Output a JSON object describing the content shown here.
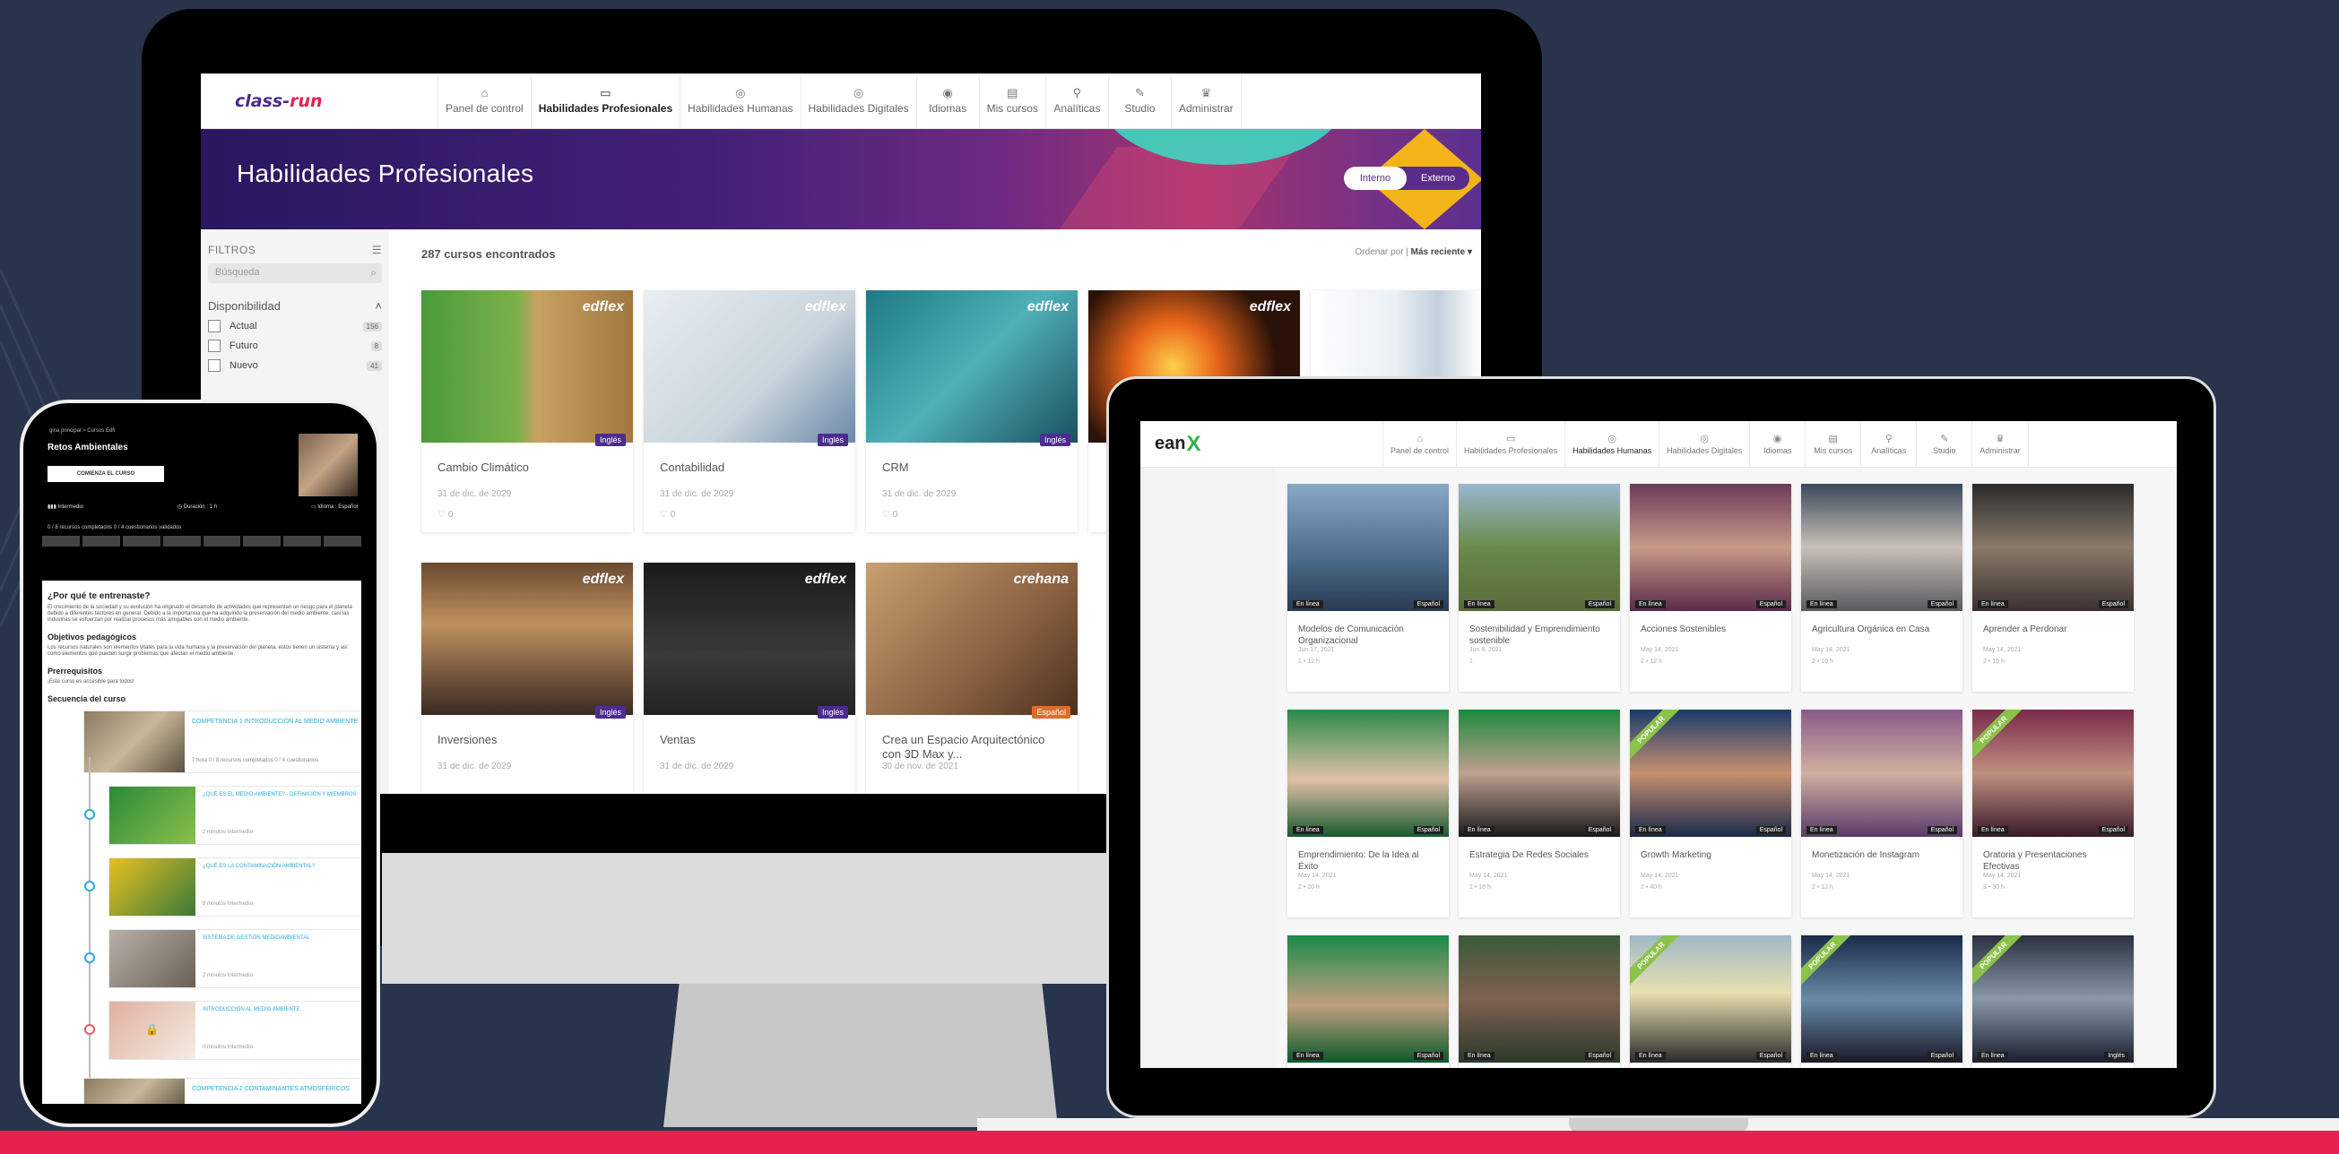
{
  "monitor": {
    "logo": {
      "part1": "class-",
      "part2": "run"
    },
    "nav": [
      {
        "icon": "⌂",
        "label": "Panel de control",
        "active": false
      },
      {
        "icon": "▭",
        "label": "Habilidades Profesionales",
        "active": true
      },
      {
        "icon": "◎",
        "label": "Habilidades Humanas",
        "active": false
      },
      {
        "icon": "◎",
        "label": "Habilidades Digitales",
        "active": false
      },
      {
        "icon": "◉",
        "label": "Idiomas",
        "active": false
      },
      {
        "icon": "▤",
        "label": "Mis cursos",
        "active": false
      },
      {
        "icon": "⚲",
        "label": "Analíticas",
        "active": false
      },
      {
        "icon": "✎",
        "label": "Studio",
        "active": false
      },
      {
        "icon": "♛",
        "label": "Administrar",
        "active": false
      }
    ],
    "hero_title": "Habilidades Profesionales",
    "toggle": {
      "interno": "Interno",
      "externo": "Externo"
    },
    "filters": {
      "title": "FILTROS",
      "search_placeholder": "Búsqueda",
      "section": "Disponibilidad",
      "options": [
        {
          "label": "Actual",
          "count": "156"
        },
        {
          "label": "Futuro",
          "count": "8"
        },
        {
          "label": "Nuevo",
          "count": "41"
        }
      ]
    },
    "results": "287 cursos encontrados",
    "sort": {
      "label": "Ordenar por |",
      "value": "Más reciente ▾"
    },
    "cards": [
      {
        "title": "Cambio Climático",
        "date": "31 de dic. de 2029",
        "likes": "0",
        "lang": "Inglés",
        "brand": "edflex"
      },
      {
        "title": "Contabilidad",
        "date": "31 de dic. de 2029",
        "likes": "0",
        "lang": "Inglés",
        "brand": "edflex"
      },
      {
        "title": "CRM",
        "date": "31 de dic. de 2029",
        "likes": "0",
        "lang": "Inglés",
        "brand": "edflex"
      },
      {
        "title": "",
        "date": "",
        "likes": "",
        "lang": "",
        "brand": "edflex"
      },
      {
        "title": "Inversiones",
        "date": "31 de dic. de 2029",
        "likes": "",
        "lang": "Inglés",
        "brand": "edflex"
      },
      {
        "title": "Ventas",
        "date": "31 de dic. de 2029",
        "likes": "",
        "lang": "Inglés",
        "brand": "edflex"
      },
      {
        "title": "Crea un Espacio Arquitectónico con 3D Max y...",
        "date": "30 de nov. de 2021",
        "likes": "",
        "lang": "Español",
        "brand": "crehana"
      }
    ]
  },
  "laptop": {
    "logo": {
      "part1": "ean",
      "part2": "X"
    },
    "nav": [
      {
        "icon": "⌂",
        "label": "Panel de control"
      },
      {
        "icon": "▭",
        "label": "Habilidades Profesionales"
      },
      {
        "icon": "◎",
        "label": "Habilidades Humanas"
      },
      {
        "icon": "◎",
        "label": "Habilidades Digitales"
      },
      {
        "icon": "◉",
        "label": "Idiomas"
      },
      {
        "icon": "▤",
        "label": "Mis cursos"
      },
      {
        "icon": "⚲",
        "label": "Analíticas"
      },
      {
        "icon": "✎",
        "label": "Studio"
      },
      {
        "icon": "♛",
        "label": "Administrar"
      }
    ],
    "tag_online": "En línea",
    "cards": [
      {
        "title": "Modelos de Comunicación Organizacional",
        "date": "Jun 17, 2021",
        "meta": "1 • 12 h",
        "lang": "Español",
        "popular": false
      },
      {
        "title": "Sostenibilidad y Emprendimiento sostenible",
        "date": "Jun 8, 2021",
        "meta": "1",
        "lang": "Español",
        "popular": false
      },
      {
        "title": "Acciones Sostenibles",
        "date": "May 14, 2021",
        "meta": "2 • 12 h",
        "lang": "Español",
        "popular": false
      },
      {
        "title": "Agricultura Orgánica en Casa",
        "date": "May 14, 2021",
        "meta": "2 • 10 h",
        "lang": "Español",
        "popular": false
      },
      {
        "title": "Aprender a Perdonar",
        "date": "May 14, 2021",
        "meta": "2 • 15 h",
        "lang": "Español",
        "popular": false
      },
      {
        "title": "Emprendimiento: De la Idea al Éxito",
        "date": "May 14, 2021",
        "meta": "2 • 20 h",
        "lang": "Español",
        "popular": false
      },
      {
        "title": "Estrategia De Redes Sociales",
        "date": "May 14, 2021",
        "meta": "2 • 18 h",
        "lang": "Español",
        "popular": false
      },
      {
        "title": "Growth Marketing",
        "date": "May 14, 2021",
        "meta": "2 • 40 h",
        "lang": "Español",
        "popular": true
      },
      {
        "title": "Monetización de Instagram",
        "date": "May 14, 2021",
        "meta": "2 • 12 h",
        "lang": "Español",
        "popular": false
      },
      {
        "title": "Oratoria y Presentaciones Efectivas",
        "date": "May 14, 2021",
        "meta": "3 • 30 h",
        "lang": "Español",
        "popular": true
      },
      {
        "title": "",
        "date": "",
        "meta": "",
        "lang": "Español",
        "popular": false
      },
      {
        "title": "",
        "date": "",
        "meta": "",
        "lang": "Español",
        "popular": false
      },
      {
        "title": "",
        "date": "",
        "meta": "",
        "lang": "Español",
        "popular": true
      },
      {
        "title": "",
        "date": "",
        "meta": "",
        "lang": "Español",
        "popular": true
      },
      {
        "title": "",
        "date": "",
        "meta": "",
        "lang": "Inglés",
        "popular": true
      }
    ],
    "popular_label": "POPULAR"
  },
  "phone": {
    "breadcrumb": "gina principal > Cursos Edfi",
    "title": "Retos Ambientales",
    "start_button": "COMIENZA EL CURSO",
    "stats": {
      "level": "Intermedio",
      "duration": "Duración : 1 h",
      "language": "Idioma : Español"
    },
    "progress": "0 / 8 recursos completados    0 / 4 cuestionarios validados",
    "why_title": "¿Por qué te entrenaste?",
    "why_text": "El crecimiento de la sociedad y su evolución ha originado el desarrollo de actividades que representan un riesgo para el planeta debido a diferentes factores en general. Debido a la importancia que ha adquirido la preservación del medio ambiente, casi las industrias se esfuerzan por realizar procesos más amigables con el medio ambiente.",
    "objectives_title": "Objetivos pedagógicos",
    "objectives_text": "Los recursos naturales son elementos vitales para la vida humana y la preservación del planeta, estos tienen un sistema y así como elementos que pueden surgir problemas que afectan el medio ambiente.",
    "prereq_title": "Prerrequisitos",
    "prereq_text": "¡Este curso es accesible para todos!",
    "sequence_title": "Secuencia del curso",
    "competence": {
      "label": "COMPETENCIA 1   INTRODUCCIÓN AL MEDIO AMBIENTE",
      "meta": "7 hora    0 / 8 recursos completados    0 / 4 cuestionarios"
    },
    "items": [
      {
        "caption": "¿QUÉ ES EL MEDIO AMBIENTE? - DEFINICIÓN Y MIEMBROS",
        "meta": "2 minutos        Intermedio"
      },
      {
        "caption": "¿QUÉ ES LA CONTAMINACIÓN AMBIENTAL?",
        "meta": "8 minutos        Intermedio"
      },
      {
        "caption": "SISTEMA DE GESTIÓN MEDIOAMBIENTAL",
        "meta": "2 minutos        Intermedio"
      },
      {
        "caption": "INTRODUCCIÓN AL MEDIO AMBIENTE",
        "meta": "0 minutos        Intermedio"
      }
    ],
    "competence2": "COMPETENCIA 2   CONTAMINANTES ATMOSFÉRICOS"
  }
}
